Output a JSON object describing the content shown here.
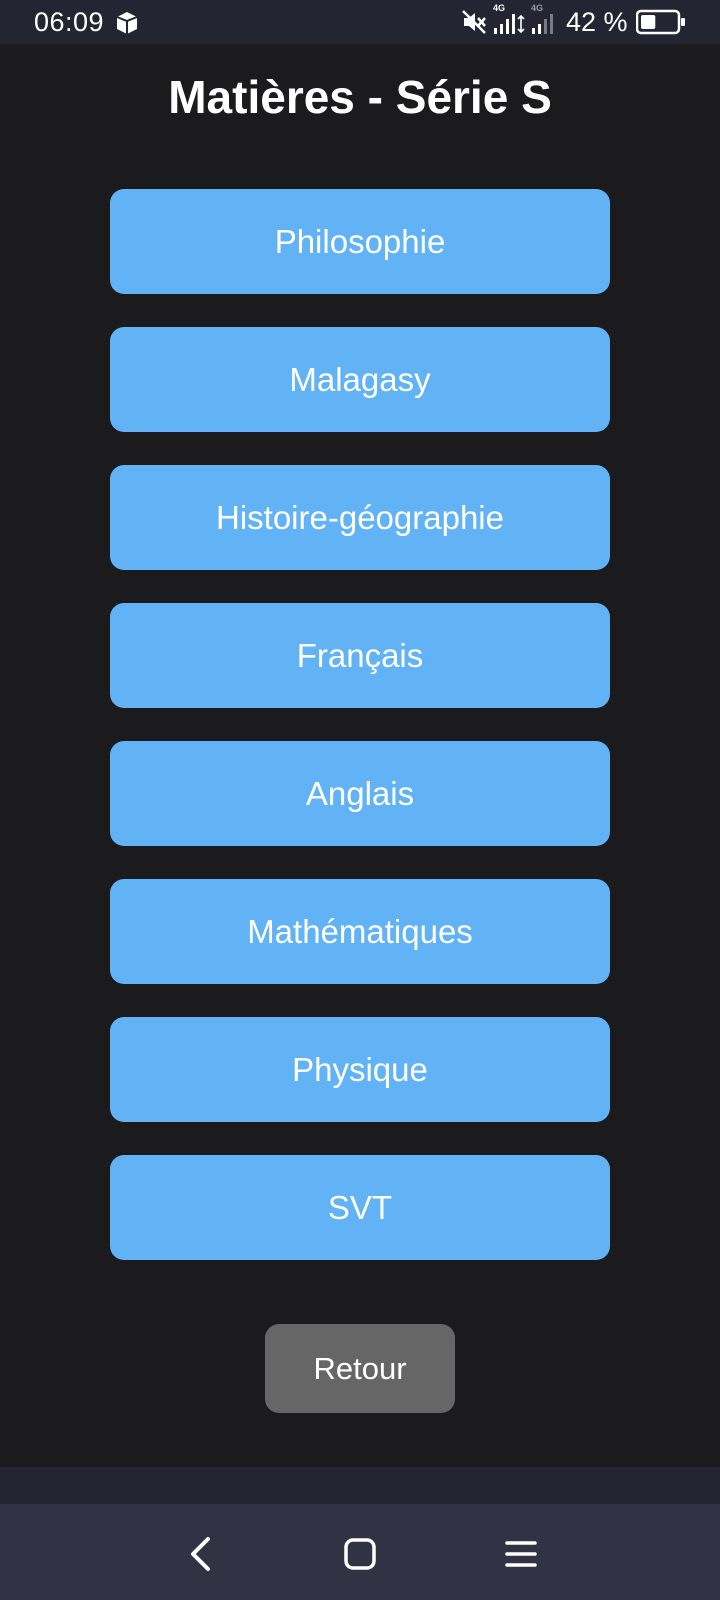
{
  "status_bar": {
    "time": "06:09",
    "network_label_1": "4G",
    "network_label_2": "4G",
    "battery_percent": "42 %",
    "battery_level": 0.42,
    "icons": [
      "app-notification-icon",
      "mute-icon",
      "signal-icon",
      "signal-icon",
      "battery-icon"
    ]
  },
  "page": {
    "title": "Matières - Série S"
  },
  "subjects": [
    {
      "label": "Philosophie"
    },
    {
      "label": "Malagasy"
    },
    {
      "label": "Histoire-géographie"
    },
    {
      "label": "Français"
    },
    {
      "label": "Anglais"
    },
    {
      "label": "Mathématiques"
    },
    {
      "label": "Physique"
    },
    {
      "label": "SVT"
    }
  ],
  "actions": {
    "back_label": "Retour"
  },
  "navigation_bar": {
    "icons": [
      "back-icon",
      "home-icon",
      "menu-icon"
    ]
  },
  "colors": {
    "background": "#1b1b1d",
    "subject_button": "#62b3f5",
    "back_button": "#666666",
    "status_bar": "#242533",
    "nav_bar": "#313344",
    "text": "#ffffff"
  }
}
